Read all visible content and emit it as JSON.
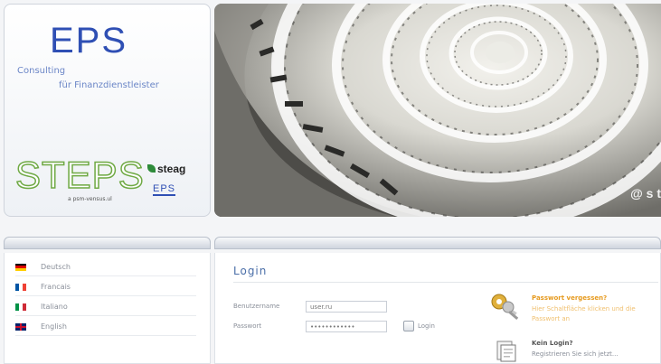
{
  "branding": {
    "eps_logo": "EPS",
    "tagline_line1": "Consulting",
    "tagline_line2": "für Finanzdienstleister",
    "steps_logo": "STEPS",
    "steps_subtext": "a psm-vensus.ul",
    "steag_logo": "steag",
    "eps_small_logo": "EPS",
    "hero_watermark": "@ s t"
  },
  "languages": [
    {
      "label": "Deutsch",
      "flag": "de"
    },
    {
      "label": "Francais",
      "flag": "fr"
    },
    {
      "label": "Italiano",
      "flag": "it"
    },
    {
      "label": "English",
      "flag": "gb"
    }
  ],
  "login": {
    "title": "Login",
    "username_label": "Benutzername",
    "username_value": "user.ru",
    "password_label": "Passwort",
    "password_value": "••••••••••••",
    "button_label": "Login"
  },
  "help": {
    "forgot_title": "Passwort vergessen?",
    "forgot_desc_line1": "Hier Schaltfläche klicken und die",
    "forgot_desc_line2": "Passwort an",
    "nologin_title": "Kein Login?",
    "nologin_desc": "Registrieren Sie sich jetzt..."
  },
  "colors": {
    "brand_blue": "#2f4fb4",
    "steps_green": "#6fa944",
    "warning_orange": "#e69a1e"
  }
}
